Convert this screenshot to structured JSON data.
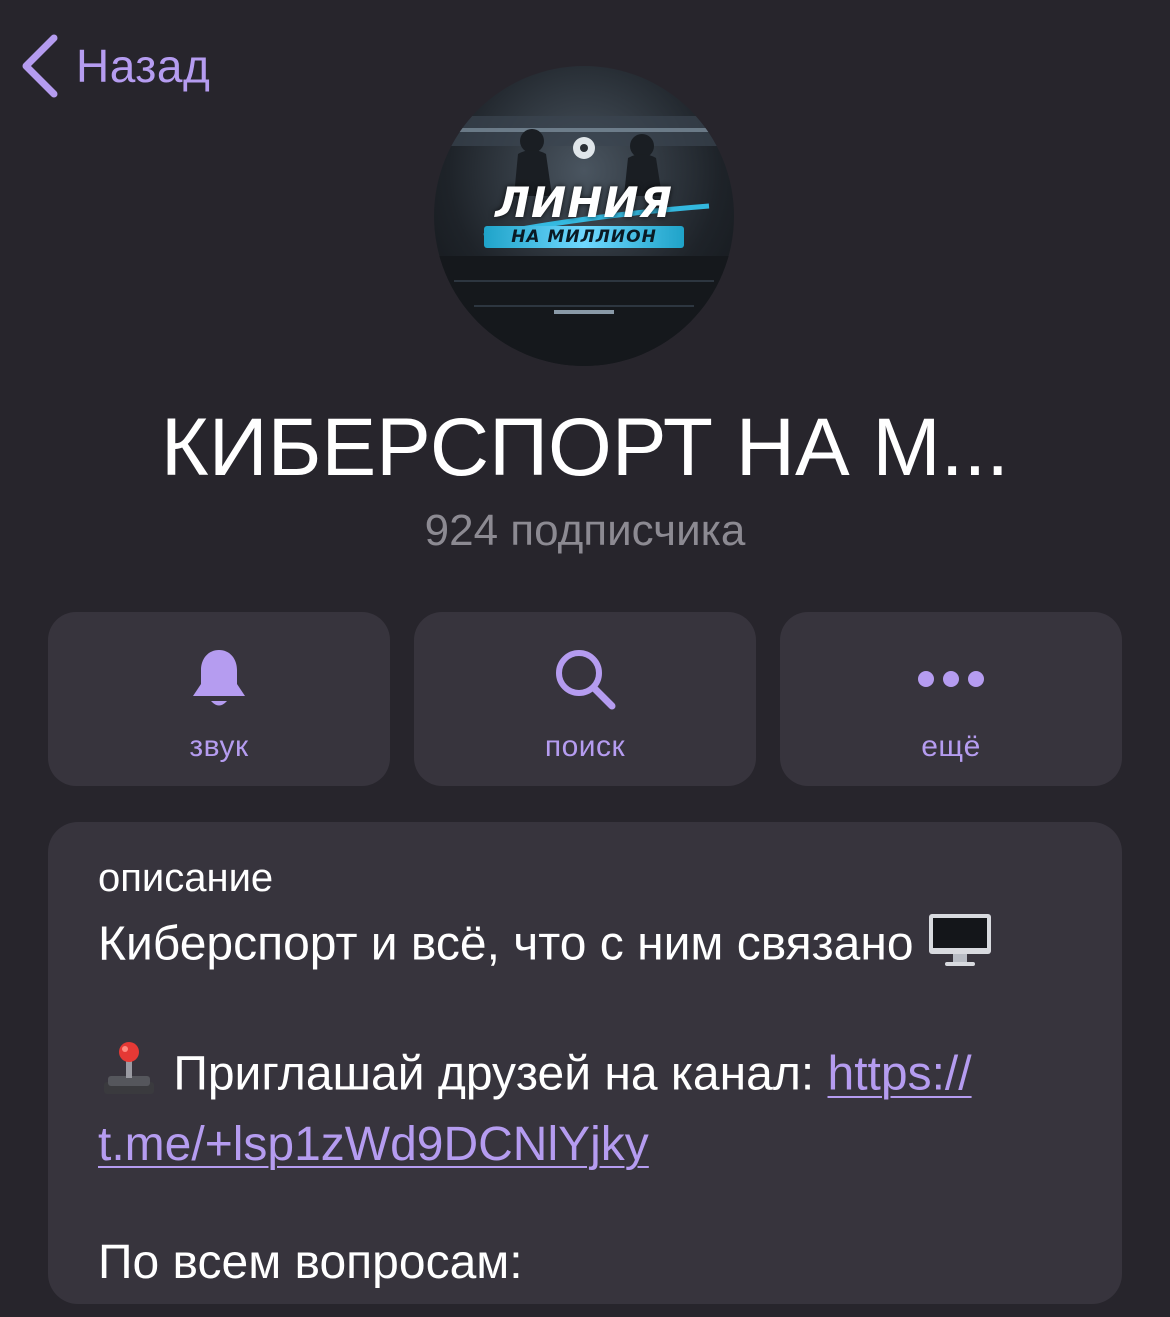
{
  "nav": {
    "back_label": "Назад"
  },
  "avatar": {
    "logo_title": "ЛИНИЯ",
    "logo_subtitle": "НА МИЛЛИОН"
  },
  "channel": {
    "title": "КИБЕРСПОРТ НА М...",
    "subscribers": "924 подписчика"
  },
  "actions": [
    {
      "label": "звук",
      "icon": "bell-icon"
    },
    {
      "label": "поиск",
      "icon": "search-icon"
    },
    {
      "label": "ещё",
      "icon": "more-dots-icon"
    }
  ],
  "description": {
    "label": "описание",
    "line1": "Киберспорт и всё, что с ним связано",
    "line1_emoji": "desktop-computer-icon",
    "invite_emoji": "joystick-icon",
    "invite_text": "Приглашай друзей на канал:",
    "invite_link_part1": "https://",
    "invite_link_part2": "t.me/+lsp1zWd9DCNlYjky",
    "questions": "По всем вопросам:"
  },
  "colors": {
    "background": "#27252c",
    "card": "#37343d",
    "accent": "#b59cf0",
    "secondary_text": "#8c8a92",
    "primary_text": "#ffffff"
  }
}
